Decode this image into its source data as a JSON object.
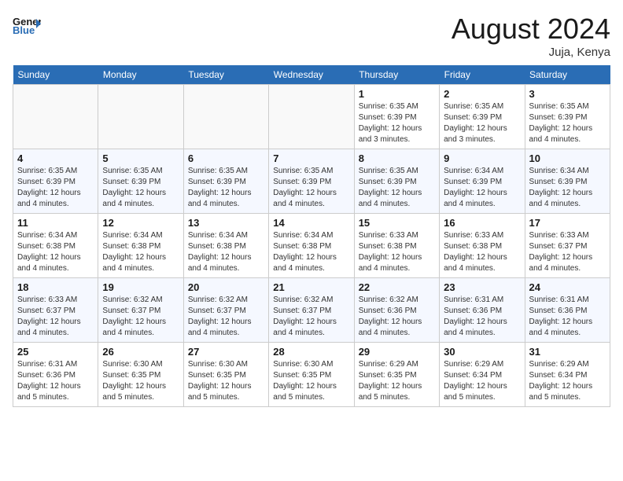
{
  "header": {
    "logo_general": "General",
    "logo_blue": "Blue",
    "month_year": "August 2024",
    "location": "Juja, Kenya"
  },
  "days_of_week": [
    "Sunday",
    "Monday",
    "Tuesday",
    "Wednesday",
    "Thursday",
    "Friday",
    "Saturday"
  ],
  "weeks": [
    [
      {
        "num": "",
        "info": ""
      },
      {
        "num": "",
        "info": ""
      },
      {
        "num": "",
        "info": ""
      },
      {
        "num": "",
        "info": ""
      },
      {
        "num": "1",
        "info": "Sunrise: 6:35 AM\nSunset: 6:39 PM\nDaylight: 12 hours and 3 minutes."
      },
      {
        "num": "2",
        "info": "Sunrise: 6:35 AM\nSunset: 6:39 PM\nDaylight: 12 hours and 3 minutes."
      },
      {
        "num": "3",
        "info": "Sunrise: 6:35 AM\nSunset: 6:39 PM\nDaylight: 12 hours and 4 minutes."
      }
    ],
    [
      {
        "num": "4",
        "info": "Sunrise: 6:35 AM\nSunset: 6:39 PM\nDaylight: 12 hours and 4 minutes."
      },
      {
        "num": "5",
        "info": "Sunrise: 6:35 AM\nSunset: 6:39 PM\nDaylight: 12 hours and 4 minutes."
      },
      {
        "num": "6",
        "info": "Sunrise: 6:35 AM\nSunset: 6:39 PM\nDaylight: 12 hours and 4 minutes."
      },
      {
        "num": "7",
        "info": "Sunrise: 6:35 AM\nSunset: 6:39 PM\nDaylight: 12 hours and 4 minutes."
      },
      {
        "num": "8",
        "info": "Sunrise: 6:35 AM\nSunset: 6:39 PM\nDaylight: 12 hours and 4 minutes."
      },
      {
        "num": "9",
        "info": "Sunrise: 6:34 AM\nSunset: 6:39 PM\nDaylight: 12 hours and 4 minutes."
      },
      {
        "num": "10",
        "info": "Sunrise: 6:34 AM\nSunset: 6:39 PM\nDaylight: 12 hours and 4 minutes."
      }
    ],
    [
      {
        "num": "11",
        "info": "Sunrise: 6:34 AM\nSunset: 6:38 PM\nDaylight: 12 hours and 4 minutes."
      },
      {
        "num": "12",
        "info": "Sunrise: 6:34 AM\nSunset: 6:38 PM\nDaylight: 12 hours and 4 minutes."
      },
      {
        "num": "13",
        "info": "Sunrise: 6:34 AM\nSunset: 6:38 PM\nDaylight: 12 hours and 4 minutes."
      },
      {
        "num": "14",
        "info": "Sunrise: 6:34 AM\nSunset: 6:38 PM\nDaylight: 12 hours and 4 minutes."
      },
      {
        "num": "15",
        "info": "Sunrise: 6:33 AM\nSunset: 6:38 PM\nDaylight: 12 hours and 4 minutes."
      },
      {
        "num": "16",
        "info": "Sunrise: 6:33 AM\nSunset: 6:38 PM\nDaylight: 12 hours and 4 minutes."
      },
      {
        "num": "17",
        "info": "Sunrise: 6:33 AM\nSunset: 6:37 PM\nDaylight: 12 hours and 4 minutes."
      }
    ],
    [
      {
        "num": "18",
        "info": "Sunrise: 6:33 AM\nSunset: 6:37 PM\nDaylight: 12 hours and 4 minutes."
      },
      {
        "num": "19",
        "info": "Sunrise: 6:32 AM\nSunset: 6:37 PM\nDaylight: 12 hours and 4 minutes."
      },
      {
        "num": "20",
        "info": "Sunrise: 6:32 AM\nSunset: 6:37 PM\nDaylight: 12 hours and 4 minutes."
      },
      {
        "num": "21",
        "info": "Sunrise: 6:32 AM\nSunset: 6:37 PM\nDaylight: 12 hours and 4 minutes."
      },
      {
        "num": "22",
        "info": "Sunrise: 6:32 AM\nSunset: 6:36 PM\nDaylight: 12 hours and 4 minutes."
      },
      {
        "num": "23",
        "info": "Sunrise: 6:31 AM\nSunset: 6:36 PM\nDaylight: 12 hours and 4 minutes."
      },
      {
        "num": "24",
        "info": "Sunrise: 6:31 AM\nSunset: 6:36 PM\nDaylight: 12 hours and 4 minutes."
      }
    ],
    [
      {
        "num": "25",
        "info": "Sunrise: 6:31 AM\nSunset: 6:36 PM\nDaylight: 12 hours and 5 minutes."
      },
      {
        "num": "26",
        "info": "Sunrise: 6:30 AM\nSunset: 6:35 PM\nDaylight: 12 hours and 5 minutes."
      },
      {
        "num": "27",
        "info": "Sunrise: 6:30 AM\nSunset: 6:35 PM\nDaylight: 12 hours and 5 minutes."
      },
      {
        "num": "28",
        "info": "Sunrise: 6:30 AM\nSunset: 6:35 PM\nDaylight: 12 hours and 5 minutes."
      },
      {
        "num": "29",
        "info": "Sunrise: 6:29 AM\nSunset: 6:35 PM\nDaylight: 12 hours and 5 minutes."
      },
      {
        "num": "30",
        "info": "Sunrise: 6:29 AM\nSunset: 6:34 PM\nDaylight: 12 hours and 5 minutes."
      },
      {
        "num": "31",
        "info": "Sunrise: 6:29 AM\nSunset: 6:34 PM\nDaylight: 12 hours and 5 minutes."
      }
    ]
  ]
}
